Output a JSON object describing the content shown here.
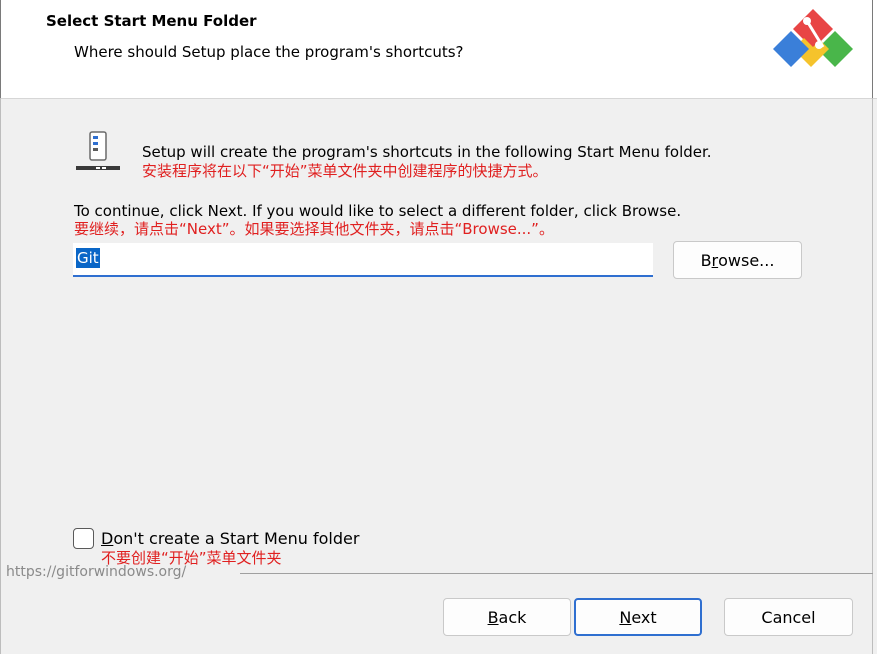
{
  "header": {
    "title": "Select Start Menu Folder",
    "subtitle": "Where should Setup place the program's shortcuts?",
    "logo": "git-logo-icon"
  },
  "main": {
    "description": "Setup will create the program's shortcuts in the following Start Menu folder.",
    "description_cn": "安装程序将在以下“开始”菜单文件夹中创建程序的快捷方式。",
    "continue_text": "To continue, click Next. If you would like to select a different folder, click Browse.",
    "continue_text_cn": "要继续，请点击“Next”。如果要选择其他文件夹，请点击“Browse...”。",
    "folder_value": "Git",
    "browse_label_pre": "B",
    "browse_label_u": "r",
    "browse_label_post": "owse..."
  },
  "checkbox": {
    "label_u": "D",
    "label_rest": "on't create a Start Menu folder",
    "label_cn": "不要创建“开始”菜单文件夹",
    "checked": false
  },
  "footer": {
    "url": "https://gitforwindows.org/",
    "back_u": "B",
    "back_rest": "ack",
    "next_u": "N",
    "next_rest": "ext",
    "cancel_label": "Cancel"
  },
  "colors": {
    "accent": "#2f6fd0",
    "annotation_red": "#e02020",
    "selection": "#0a66c7"
  }
}
